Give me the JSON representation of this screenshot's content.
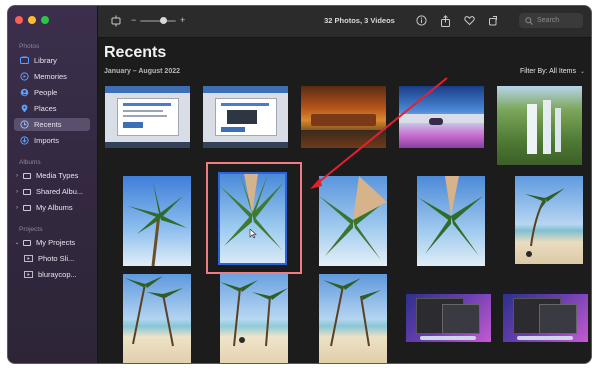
{
  "sidebar": {
    "sections": {
      "photos": "Photos",
      "albums": "Albums",
      "projects": "Projects"
    },
    "items": [
      {
        "label": "Library",
        "icon": "library-icon"
      },
      {
        "label": "Memories",
        "icon": "memories-icon"
      },
      {
        "label": "People",
        "icon": "people-icon"
      },
      {
        "label": "Places",
        "icon": "places-icon"
      },
      {
        "label": "Recents",
        "icon": "recents-icon",
        "active": true
      },
      {
        "label": "Imports",
        "icon": "imports-icon"
      }
    ],
    "albums": [
      {
        "label": "Media Types"
      },
      {
        "label": "Shared Albu..."
      },
      {
        "label": "My Albums"
      }
    ],
    "projects": [
      {
        "label": "My Projects"
      },
      {
        "label": "Photo Sli..."
      },
      {
        "label": "bluraycop..."
      }
    ]
  },
  "toolbar": {
    "title": "32 Photos, 3 Videos",
    "zoom_minus": "−",
    "zoom_plus": "+",
    "search_placeholder": "Search"
  },
  "main": {
    "heading": "Recents",
    "date_range": "January – August 2022",
    "filter_label": "Filter By: All Items"
  },
  "grid": {
    "rows": 3,
    "columns": 5,
    "selected_index": 6,
    "highlight_color": "#f07b82",
    "selection_color": "#2e62d9",
    "arrow_color": "#e5202d",
    "thumbnails": [
      "screenshot",
      "screenshot",
      "autumn-pond",
      "purple-lake",
      "waterfall",
      "palm-tree",
      "palm-tree",
      "palm-tree",
      "palm-tree",
      "beach",
      "beach",
      "beach",
      "beach",
      "desktop",
      "desktop"
    ]
  }
}
